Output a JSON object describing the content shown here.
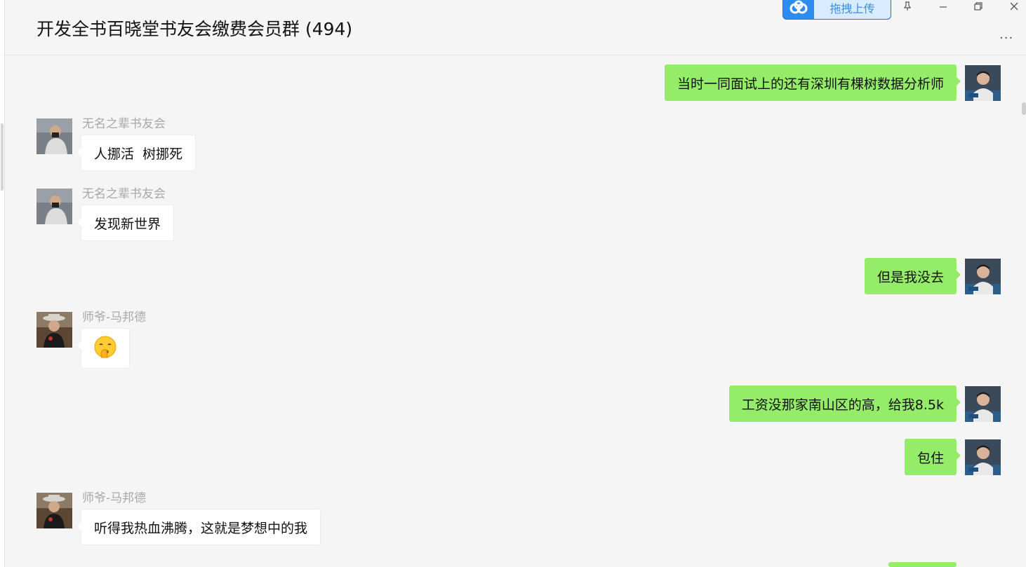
{
  "header": {
    "title": "开发全书百晓堂书友会缴费会员群 (494)",
    "upload_label": "拖拽上传",
    "more_label": "···"
  },
  "colors": {
    "outgoing_bubble": "#95ec69",
    "incoming_bubble": "#ffffff",
    "background": "#f5f5f5",
    "upload_accent": "#2d8cf0"
  },
  "messages": [
    {
      "direction": "out",
      "text": "当时一同面试上的还有深圳有棵树数据分析师"
    },
    {
      "direction": "in",
      "sender": "无名之辈书友会",
      "text": "人挪活  树挪死"
    },
    {
      "direction": "in",
      "sender": "无名之辈书友会",
      "text": "发现新世界"
    },
    {
      "direction": "out",
      "text": "但是我没去"
    },
    {
      "direction": "in",
      "sender": "师爷-马邦德",
      "text": "",
      "emoji": "shushing-face-icon"
    },
    {
      "direction": "out",
      "text": "工资没那家南山区的高，给我8.5k"
    },
    {
      "direction": "out",
      "text": "包住"
    },
    {
      "direction": "in",
      "sender": "师爷-马邦德",
      "text": "听得我热血沸腾，这就是梦想中的我"
    }
  ]
}
